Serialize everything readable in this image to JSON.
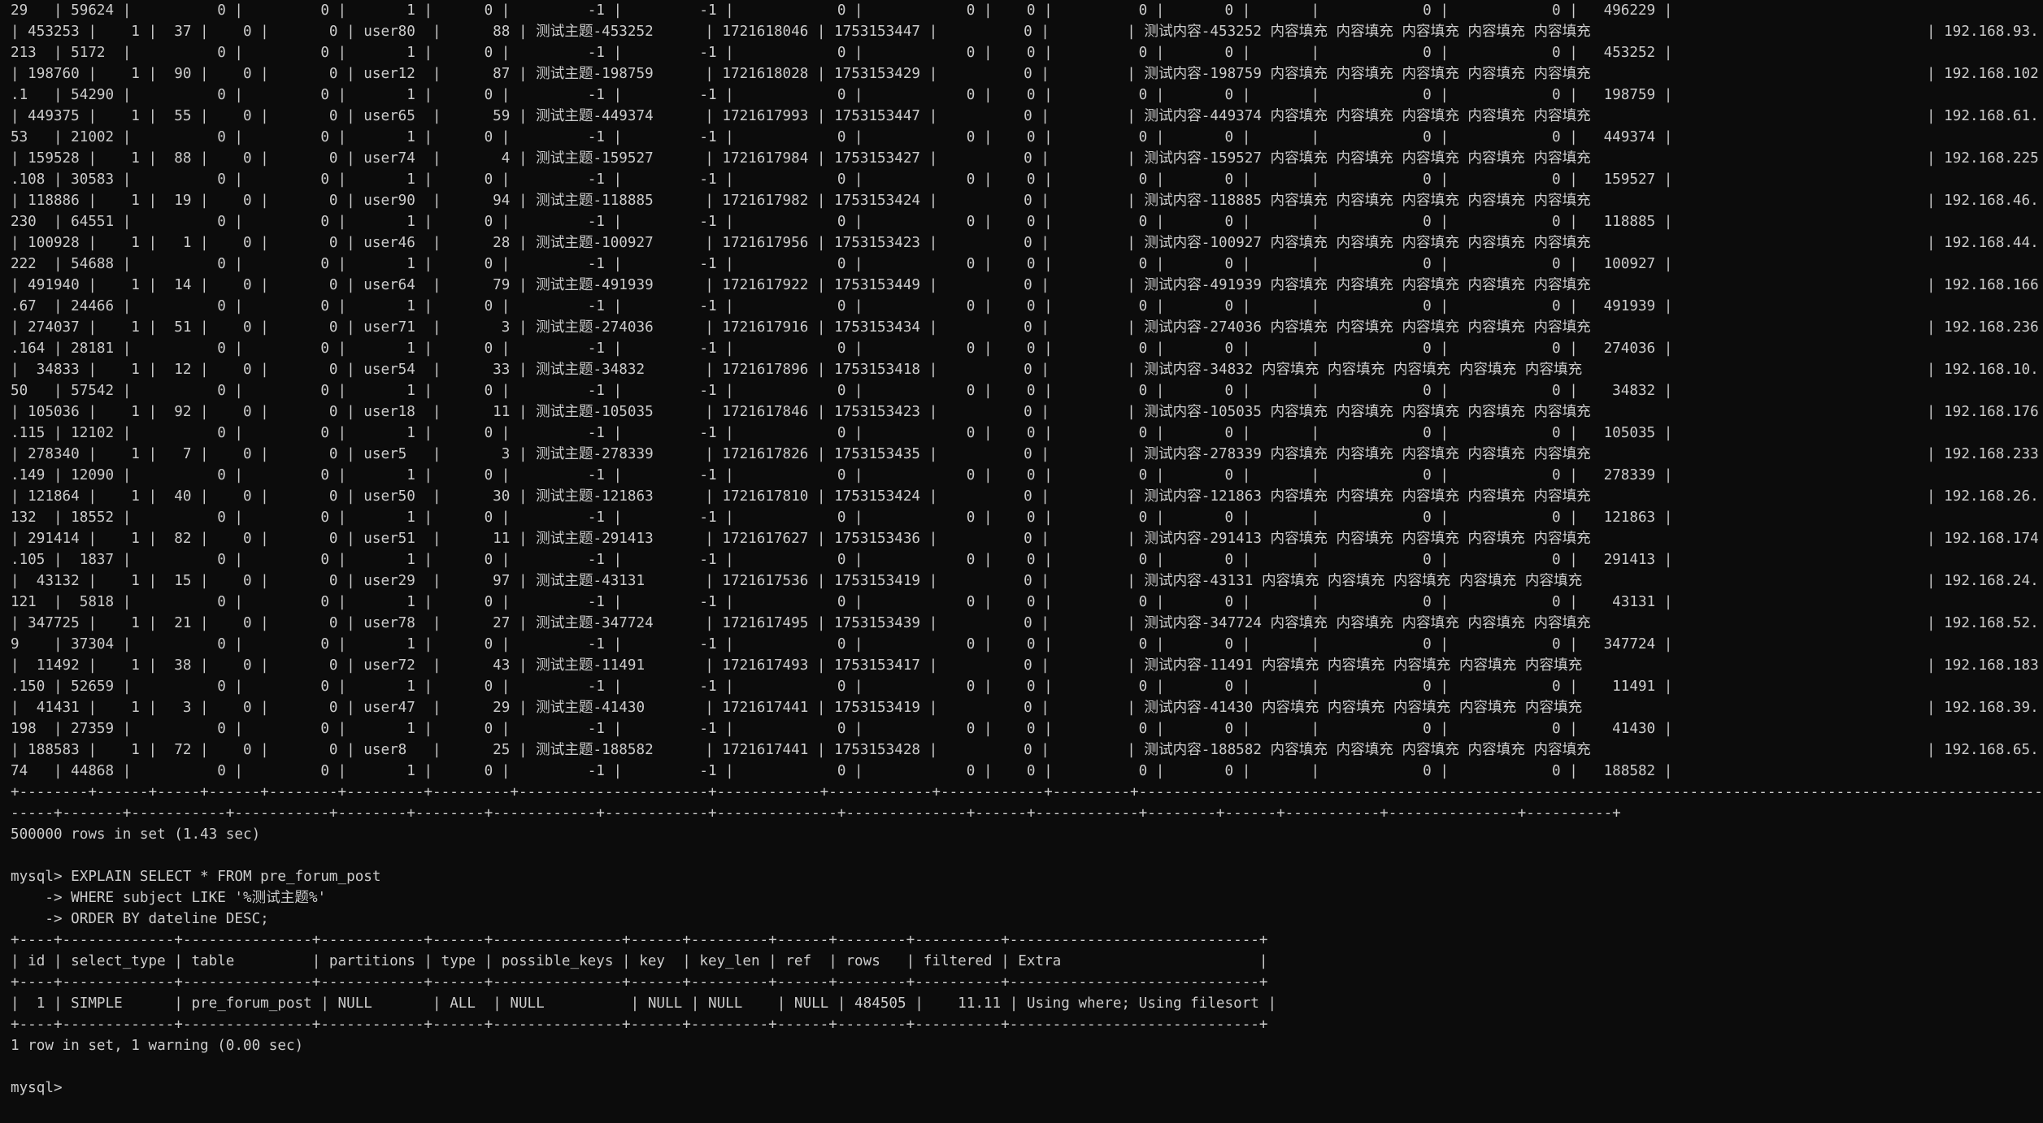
{
  "result_rows": [
    {
      "lead": "29   | 59624 |",
      "rest": "          0 |         0 |       1 |      0 |         -1 |         -1 |            0 |            0 |    0 |          0 |       0 |       |            0 |            0 |   496229 |",
      "cont": true
    },
    {
      "lead": "| 453253 |    1 |  37 |",
      "rest": "    0 |       0 | user80  |      88 | 测试主题-453252      | 1721618046 | 1753153447 |          0 |         | 测试内容-453252 内容填充 内容填充 内容填充 内容填充 内容填充",
      "ip": "| 192.168.93."
    },
    {
      "lead": "213  | 5172  |",
      "rest": "          0 |         0 |       1 |      0 |         -1 |         -1 |            0 |            0 |    0 |          0 |       0 |       |            0 |            0 |   453252 |",
      "cont": true
    },
    {
      "lead": "| 198760 |    1 |  90 |",
      "rest": "    0 |       0 | user12  |      87 | 测试主题-198759      | 1721618028 | 1753153429 |          0 |         | 测试内容-198759 内容填充 内容填充 内容填充 内容填充 内容填充",
      "ip": "| 192.168.102"
    },
    {
      "lead": ".1   | 54290 |",
      "rest": "          0 |         0 |       1 |      0 |         -1 |         -1 |            0 |            0 |    0 |          0 |       0 |       |            0 |            0 |   198759 |",
      "cont": true
    },
    {
      "lead": "| 449375 |    1 |  55 |",
      "rest": "    0 |       0 | user65  |      59 | 测试主题-449374      | 1721617993 | 1753153447 |          0 |         | 测试内容-449374 内容填充 内容填充 内容填充 内容填充 内容填充",
      "ip": "| 192.168.61."
    },
    {
      "lead": "53   | 21002 |",
      "rest": "          0 |         0 |       1 |      0 |         -1 |         -1 |            0 |            0 |    0 |          0 |       0 |       |            0 |            0 |   449374 |",
      "cont": true
    },
    {
      "lead": "| 159528 |    1 |  88 |",
      "rest": "    0 |       0 | user74  |       4 | 测试主题-159527      | 1721617984 | 1753153427 |          0 |         | 测试内容-159527 内容填充 内容填充 内容填充 内容填充 内容填充",
      "ip": "| 192.168.225"
    },
    {
      "lead": ".108 | 30583 |",
      "rest": "          0 |         0 |       1 |      0 |         -1 |         -1 |            0 |            0 |    0 |          0 |       0 |       |            0 |            0 |   159527 |",
      "cont": true
    },
    {
      "lead": "| 118886 |    1 |  19 |",
      "rest": "    0 |       0 | user90  |      94 | 测试主题-118885      | 1721617982 | 1753153424 |          0 |         | 测试内容-118885 内容填充 内容填充 内容填充 内容填充 内容填充",
      "ip": "| 192.168.46."
    },
    {
      "lead": "230  | 64551 |",
      "rest": "          0 |         0 |       1 |      0 |         -1 |         -1 |            0 |            0 |    0 |          0 |       0 |       |            0 |            0 |   118885 |",
      "cont": true
    },
    {
      "lead": "| 100928 |    1 |   1 |",
      "rest": "    0 |       0 | user46  |      28 | 测试主题-100927      | 1721617956 | 1753153423 |          0 |         | 测试内容-100927 内容填充 内容填充 内容填充 内容填充 内容填充",
      "ip": "| 192.168.44."
    },
    {
      "lead": "222  | 54688 |",
      "rest": "          0 |         0 |       1 |      0 |         -1 |         -1 |            0 |            0 |    0 |          0 |       0 |       |            0 |            0 |   100927 |",
      "cont": true
    },
    {
      "lead": "| 491940 |    1 |  14 |",
      "rest": "    0 |       0 | user64  |      79 | 测试主题-491939      | 1721617922 | 1753153449 |          0 |         | 测试内容-491939 内容填充 内容填充 内容填充 内容填充 内容填充",
      "ip": "| 192.168.166"
    },
    {
      "lead": ".67  | 24466 |",
      "rest": "          0 |         0 |       1 |      0 |         -1 |         -1 |            0 |            0 |    0 |          0 |       0 |       |            0 |            0 |   491939 |",
      "cont": true
    },
    {
      "lead": "| 274037 |    1 |  51 |",
      "rest": "    0 |       0 | user71  |       3 | 测试主题-274036      | 1721617916 | 1753153434 |          0 |         | 测试内容-274036 内容填充 内容填充 内容填充 内容填充 内容填充",
      "ip": "| 192.168.236"
    },
    {
      "lead": ".164 | 28181 |",
      "rest": "          0 |         0 |       1 |      0 |         -1 |         -1 |            0 |            0 |    0 |          0 |       0 |       |            0 |            0 |   274036 |",
      "cont": true
    },
    {
      "lead": "|  34833 |    1 |  12 |",
      "rest": "    0 |       0 | user54  |      33 | 测试主题-34832       | 1721617896 | 1753153418 |          0 |         | 测试内容-34832 内容填充 内容填充 内容填充 内容填充 内容填充",
      "ip": "| 192.168.10."
    },
    {
      "lead": "50   | 57542 |",
      "rest": "          0 |         0 |       1 |      0 |         -1 |         -1 |            0 |            0 |    0 |          0 |       0 |       |            0 |            0 |    34832 |",
      "cont": true
    },
    {
      "lead": "| 105036 |    1 |  92 |",
      "rest": "    0 |       0 | user18  |      11 | 测试主题-105035      | 1721617846 | 1753153423 |          0 |         | 测试内容-105035 内容填充 内容填充 内容填充 内容填充 内容填充",
      "ip": "| 192.168.176"
    },
    {
      "lead": ".115 | 12102 |",
      "rest": "          0 |         0 |       1 |      0 |         -1 |         -1 |            0 |            0 |    0 |          0 |       0 |       |            0 |            0 |   105035 |",
      "cont": true
    },
    {
      "lead": "| 278340 |    1 |   7 |",
      "rest": "    0 |       0 | user5   |       3 | 测试主题-278339      | 1721617826 | 1753153435 |          0 |         | 测试内容-278339 内容填充 内容填充 内容填充 内容填充 内容填充",
      "ip": "| 192.168.233"
    },
    {
      "lead": ".149 | 12090 |",
      "rest": "          0 |         0 |       1 |      0 |         -1 |         -1 |            0 |            0 |    0 |          0 |       0 |       |            0 |            0 |   278339 |",
      "cont": true
    },
    {
      "lead": "| 121864 |    1 |  40 |",
      "rest": "    0 |       0 | user50  |      30 | 测试主题-121863      | 1721617810 | 1753153424 |          0 |         | 测试内容-121863 内容填充 内容填充 内容填充 内容填充 内容填充",
      "ip": "| 192.168.26."
    },
    {
      "lead": "132  | 18552 |",
      "rest": "          0 |         0 |       1 |      0 |         -1 |         -1 |            0 |            0 |    0 |          0 |       0 |       |            0 |            0 |   121863 |",
      "cont": true
    },
    {
      "lead": "| 291414 |    1 |  82 |",
      "rest": "    0 |       0 | user51  |      11 | 测试主题-291413      | 1721617627 | 1753153436 |          0 |         | 测试内容-291413 内容填充 内容填充 内容填充 内容填充 内容填充",
      "ip": "| 192.168.174"
    },
    {
      "lead": ".105 |  1837 |",
      "rest": "          0 |         0 |       1 |      0 |         -1 |         -1 |            0 |            0 |    0 |          0 |       0 |       |            0 |            0 |   291413 |",
      "cont": true
    },
    {
      "lead": "|  43132 |    1 |  15 |",
      "rest": "    0 |       0 | user29  |      97 | 测试主题-43131       | 1721617536 | 1753153419 |          0 |         | 测试内容-43131 内容填充 内容填充 内容填充 内容填充 内容填充",
      "ip": "| 192.168.24."
    },
    {
      "lead": "121  |  5818 |",
      "rest": "          0 |         0 |       1 |      0 |         -1 |         -1 |            0 |            0 |    0 |          0 |       0 |       |            0 |            0 |    43131 |",
      "cont": true
    },
    {
      "lead": "| 347725 |    1 |  21 |",
      "rest": "    0 |       0 | user78  |      27 | 测试主题-347724      | 1721617495 | 1753153439 |          0 |         | 测试内容-347724 内容填充 内容填充 内容填充 内容填充 内容填充",
      "ip": "| 192.168.52."
    },
    {
      "lead": "9    | 37304 |",
      "rest": "          0 |         0 |       1 |      0 |         -1 |         -1 |            0 |            0 |    0 |          0 |       0 |       |            0 |            0 |   347724 |",
      "cont": true
    },
    {
      "lead": "|  11492 |    1 |  38 |",
      "rest": "    0 |       0 | user72  |      43 | 测试主题-11491       | 1721617493 | 1753153417 |          0 |         | 测试内容-11491 内容填充 内容填充 内容填充 内容填充 内容填充",
      "ip": "| 192.168.183"
    },
    {
      "lead": ".150 | 52659 |",
      "rest": "          0 |         0 |       1 |      0 |         -1 |         -1 |            0 |            0 |    0 |          0 |       0 |       |            0 |            0 |    11491 |",
      "cont": true
    },
    {
      "lead": "|  41431 |    1 |   3 |",
      "rest": "    0 |       0 | user47  |      29 | 测试主题-41430       | 1721617441 | 1753153419 |          0 |         | 测试内容-41430 内容填充 内容填充 内容填充 内容填充 内容填充",
      "ip": "| 192.168.39."
    },
    {
      "lead": "198  | 27359 |",
      "rest": "          0 |         0 |       1 |      0 |         -1 |         -1 |            0 |            0 |    0 |          0 |       0 |       |            0 |            0 |    41430 |",
      "cont": true
    },
    {
      "lead": "| 188583 |    1 |  72 |",
      "rest": "    0 |       0 | user8   |      25 | 测试主题-188582      | 1721617441 | 1753153428 |          0 |         | 测试内容-188582 内容填充 内容填充 内容填充 内容填充 内容填充",
      "ip": "| 192.168.65."
    },
    {
      "lead": "74   | 44868 |",
      "rest": "          0 |         0 |       1 |      0 |         -1 |         -1 |            0 |            0 |    0 |          0 |       0 |       |            0 |            0 |   188582 |",
      "cont": true
    }
  ],
  "bottom_border_1": "+--------+------+-----+------+--------+---------+---------+----------------------+------------+------------+------------+---------+-------------------------------------------------------------------------------------------------------------------------------------------------------",
  "bottom_border_2": "-----+-------+-----------+-----------+--------+--------+------------+------------+--------------+--------------+------+------------+--------+------+-----------+---------------+----------+",
  "rows_summary": "500000 rows in set (1.43 sec)",
  "query": {
    "line1": "mysql> EXPLAIN SELECT * FROM pre_forum_post",
    "line2": "    -> WHERE subject LIKE '%测试主题%'",
    "line3": "    -> ORDER BY dateline DESC;"
  },
  "explain_table": {
    "border": "+----+-------------+---------------+------------+------+---------------+------+---------+------+--------+----------+-----------------------------+",
    "header": "| id | select_type | table         | partitions | type | possible_keys | key  | key_len | ref  | rows   | filtered | Extra                       |",
    "row": "|  1 | SIMPLE      | pre_forum_post | NULL       | ALL  | NULL          | NULL | NULL    | NULL | 484505 |    11.11 | Using where; Using filesort |"
  },
  "explain_summary": "1 row in set, 1 warning (0.00 sec)",
  "prompt": "mysql> "
}
